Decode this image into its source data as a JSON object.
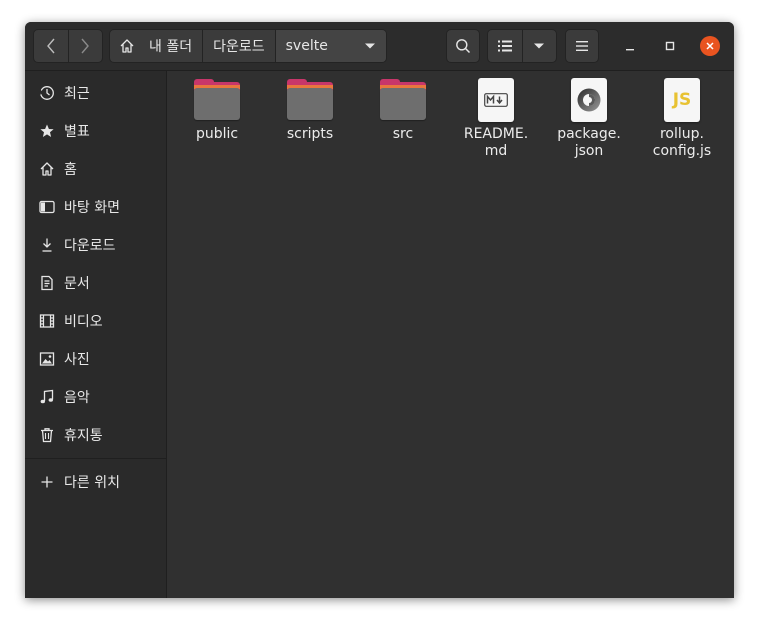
{
  "header": {
    "path": {
      "crumbs": [
        "내 폴더",
        "다운로드",
        "svelte"
      ]
    }
  },
  "sidebar": {
    "items": [
      {
        "label": "최근",
        "icon": "clock-icon"
      },
      {
        "label": "별표",
        "icon": "star-icon"
      },
      {
        "label": "홈",
        "icon": "home-icon"
      },
      {
        "label": "바탕 화면",
        "icon": "desktop-icon"
      },
      {
        "label": "다운로드",
        "icon": "download-icon"
      },
      {
        "label": "문서",
        "icon": "document-icon"
      },
      {
        "label": "비디오",
        "icon": "video-icon"
      },
      {
        "label": "사진",
        "icon": "picture-icon"
      },
      {
        "label": "음악",
        "icon": "music-icon"
      },
      {
        "label": "휴지통",
        "icon": "trash-icon"
      }
    ],
    "other_locations": {
      "label": "다른 위치",
      "icon": "plus-icon"
    }
  },
  "files": [
    {
      "name": "public",
      "type": "folder"
    },
    {
      "name": "scripts",
      "type": "folder"
    },
    {
      "name": "src",
      "type": "folder"
    },
    {
      "name": [
        "README.",
        "md"
      ],
      "type": "markdown",
      "icon_text": "M↓"
    },
    {
      "name": [
        "package.",
        "json"
      ],
      "type": "json"
    },
    {
      "name": [
        "rollup.",
        "config.js"
      ],
      "type": "javascript",
      "icon_text": "JS"
    }
  ],
  "colors": {
    "accent": "#e95420",
    "folder_tab": "#c8366a",
    "folder_stripe": "#e9763e",
    "folder_body": "#6e6e6e",
    "js_yellow": "#e8c232"
  }
}
